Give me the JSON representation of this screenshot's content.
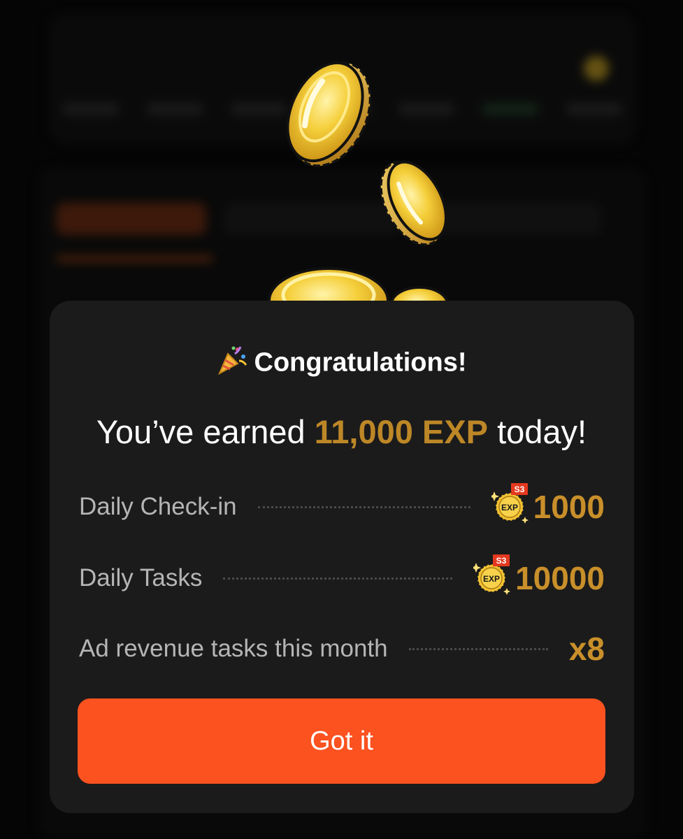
{
  "dialog": {
    "title": "Congratulations!",
    "headline": {
      "prefix": "You’ve earned ",
      "highlight": "11,000 EXP",
      "suffix": " today!"
    },
    "rows": [
      {
        "label": "Daily Check-in",
        "value": "1000",
        "badge": "S3",
        "badge_text": "EXP",
        "icon": "exp-coin-icon"
      },
      {
        "label": "Daily Tasks",
        "value": "10000",
        "badge": "S3",
        "badge_text": "EXP",
        "icon": "exp-coin-icon"
      },
      {
        "label": "Ad revenue tasks this month",
        "value": "x8"
      }
    ],
    "button_label": "Got it"
  },
  "colors": {
    "accent_orange": "#fb5220",
    "gold": "#c88f2a",
    "dialog_bg": "#1b1b1b"
  },
  "icons": [
    "party-popper-icon",
    "gold-coin-icon",
    "exp-coin-icon"
  ]
}
